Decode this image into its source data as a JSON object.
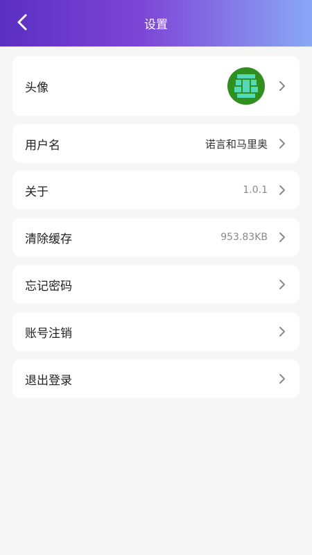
{
  "header": {
    "title": "设置",
    "back_icon": "chevron-left-icon"
  },
  "items": [
    {
      "label": "头像",
      "value": ""
    },
    {
      "label": "用户名",
      "value": "诺言和马里奥"
    },
    {
      "label": "关于",
      "value": "1.0.1"
    },
    {
      "label": "清除缓存",
      "value": "953.83KB"
    },
    {
      "label": "忘记密码",
      "value": ""
    },
    {
      "label": "账号注销",
      "value": ""
    },
    {
      "label": "退出登录",
      "value": ""
    }
  ],
  "colors": {
    "header_gradient_start": "#5a2fc2",
    "header_gradient_end": "#8aa8f5",
    "avatar_bg": "#2f8f1f",
    "avatar_fg": "#54d9b8"
  }
}
